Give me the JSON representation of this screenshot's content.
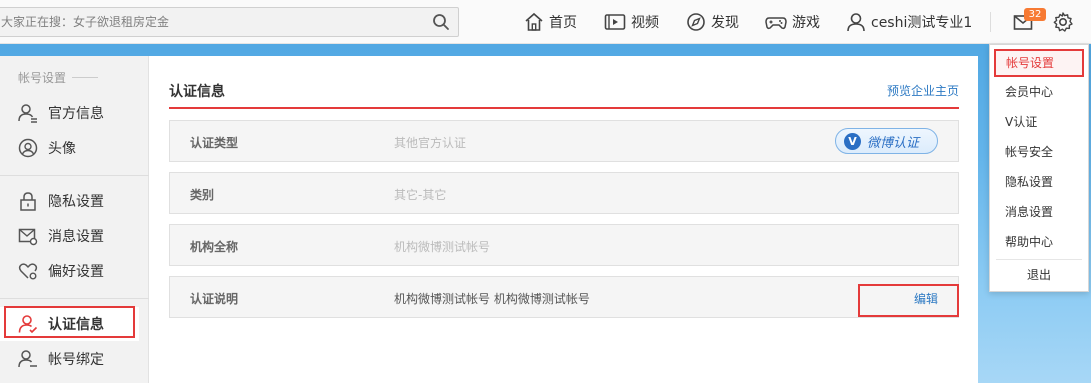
{
  "search": {
    "placeholder": "大家正在搜：女子欲退租房定金"
  },
  "nav": {
    "home": "首页",
    "video": "视频",
    "discover": "发现",
    "games": "游戏",
    "user": "ceshi测试专业1",
    "message_count": "32"
  },
  "sidebar": {
    "group_title": "帐号设置",
    "items": [
      {
        "label": "官方信息",
        "icon": "official-info-icon"
      },
      {
        "label": "头像",
        "icon": "avatar-icon"
      },
      {
        "label": "隐私设置",
        "icon": "lock-icon"
      },
      {
        "label": "消息设置",
        "icon": "message-settings-icon"
      },
      {
        "label": "偏好设置",
        "icon": "heart-settings-icon"
      },
      {
        "label": "认证信息",
        "icon": "verified-user-icon",
        "active": true
      },
      {
        "label": "帐号绑定",
        "icon": "account-bind-icon"
      }
    ]
  },
  "main": {
    "title": "认证信息",
    "preview_link": "预览企业主页",
    "rows": [
      {
        "label": "认证类型",
        "value": "其他官方认证",
        "badge": "微博认证"
      },
      {
        "label": "类别",
        "value": "其它-其它"
      },
      {
        "label": "机构全称",
        "value": "机构微博测试帐号"
      },
      {
        "label": "认证说明",
        "value": "机构微博测试帐号 机构微博测试帐号",
        "action": "编辑"
      }
    ]
  },
  "dropdown": {
    "items": [
      "帐号设置",
      "会员中心",
      "V认证",
      "帐号安全",
      "隐私设置",
      "消息设置",
      "帮助中心"
    ],
    "logout": "退出"
  },
  "colors": {
    "accent_red": "#e43a3a",
    "link_blue": "#2c79c3",
    "badge_orange": "#f77a33",
    "sky_blue": "#63b4ea"
  }
}
